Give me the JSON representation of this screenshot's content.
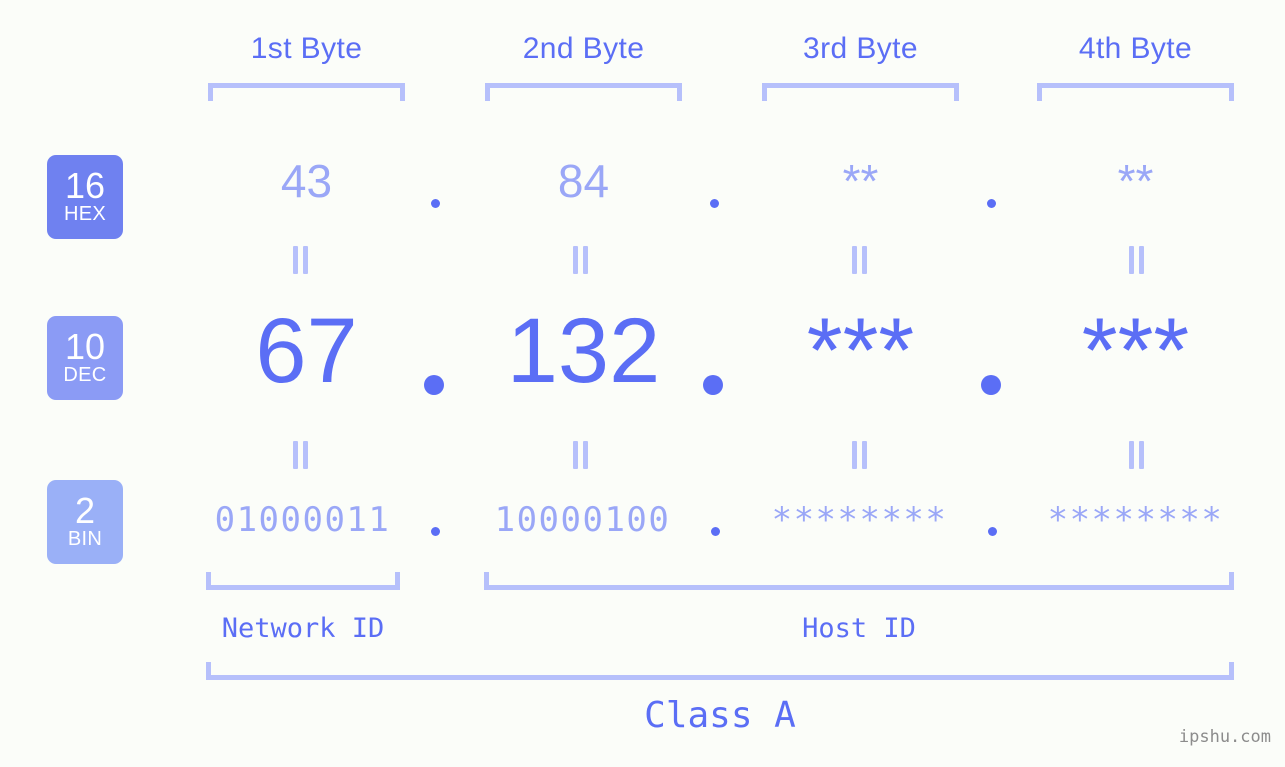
{
  "meta": {
    "background_color": "#fbfdf9",
    "accent_strong": "#5b6ef5",
    "accent_light": "#9aa7f7",
    "accent_bracket": "#b6c0fb",
    "watermark": "ipshu.com"
  },
  "headers": [
    {
      "label": "1st Byte"
    },
    {
      "label": "2nd Byte"
    },
    {
      "label": "3rd Byte"
    },
    {
      "label": "4th Byte"
    }
  ],
  "radix_badges": [
    {
      "number": "16",
      "name": "HEX",
      "color": "#6f81f0"
    },
    {
      "number": "10",
      "name": "DEC",
      "color": "#8b9bf5"
    },
    {
      "number": "2",
      "name": "BIN",
      "color": "#9ab0f7"
    }
  ],
  "rows": {
    "hex": {
      "radix": "16",
      "values": [
        "43",
        "84",
        "**",
        "**"
      ],
      "separator": "."
    },
    "dec": {
      "radix": "10",
      "values": [
        "67",
        "132",
        "***",
        "***"
      ],
      "separator": "."
    },
    "bin": {
      "radix": "2",
      "values": [
        "01000011",
        "10000100",
        "********",
        "********"
      ],
      "separator": "."
    }
  },
  "equality_marks": {
    "symbol": "=",
    "count_per_gap": 4,
    "gaps": 2
  },
  "segments": [
    {
      "id": "network",
      "label": "Network ID"
    },
    {
      "id": "host",
      "label": "Host ID"
    }
  ],
  "class_label": "Class A"
}
